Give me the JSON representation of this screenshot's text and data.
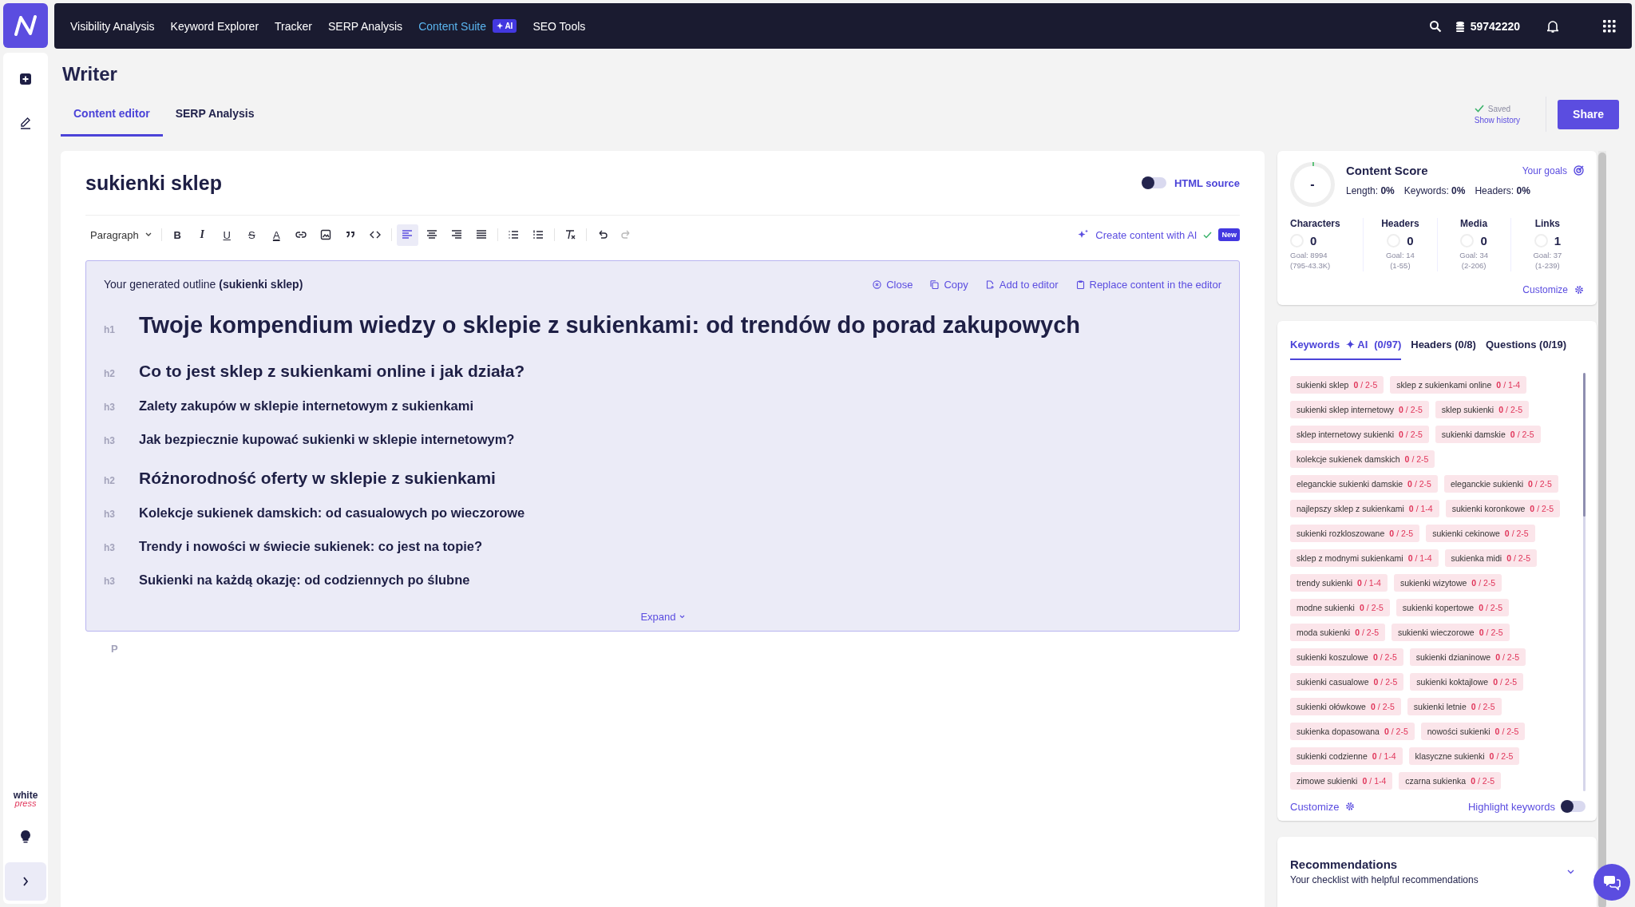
{
  "nav": {
    "items": [
      {
        "label": "Visibility Analysis",
        "selected": false
      },
      {
        "label": "Keyword Explorer",
        "selected": false
      },
      {
        "label": "Tracker",
        "selected": false
      },
      {
        "label": "SERP Analysis",
        "selected": false
      },
      {
        "label": "Content Suite",
        "selected": true,
        "badge": "✦ AI"
      },
      {
        "label": "SEO Tools",
        "selected": false
      }
    ],
    "credits": "59742220"
  },
  "page": {
    "title": "Writer",
    "tabs": [
      {
        "label": "Content editor",
        "selected": true
      },
      {
        "label": "SERP Analysis",
        "selected": false
      }
    ],
    "saved": "Saved",
    "history_link": "Show history",
    "share_button": "Share"
  },
  "editor": {
    "document_title": "sukienki sklep",
    "html_source": {
      "label": "HTML source",
      "on": false
    },
    "toolbar": [
      {
        "kind": "select",
        "label": "Paragraph"
      },
      {
        "kind": "bold",
        "label": "B",
        "selected": false
      },
      {
        "kind": "italic",
        "label": "I",
        "selected": false
      },
      {
        "kind": "underline",
        "label": "U",
        "selected": false
      },
      {
        "kind": "strike",
        "label": "S",
        "selected": false
      },
      {
        "kind": "color",
        "label": "A",
        "selected": false
      },
      {
        "kind": "link",
        "selected": false
      },
      {
        "kind": "image",
        "selected": false
      },
      {
        "kind": "quote",
        "selected": false
      },
      {
        "kind": "code",
        "selected": false
      },
      {
        "kind": "align-left",
        "selected": true
      },
      {
        "kind": "align-center",
        "selected": false
      },
      {
        "kind": "align-right",
        "selected": false
      },
      {
        "kind": "justify",
        "selected": false
      },
      {
        "kind": "bullets",
        "selected": false
      },
      {
        "kind": "numbers",
        "selected": false
      },
      {
        "kind": "clear",
        "selected": false
      },
      {
        "kind": "undo",
        "selected": false
      },
      {
        "kind": "redo",
        "selected": false,
        "disabled": true
      }
    ],
    "ai_button": "Create content with AI",
    "ai_badge": "New",
    "outline": {
      "title": "Your generated outline **(sukienki sklep)**",
      "actions": [
        {
          "kind": "close",
          "label": "Close"
        },
        {
          "kind": "copy",
          "label": "Copy"
        },
        {
          "kind": "add",
          "label": "Add to editor"
        },
        {
          "kind": "replace",
          "label": "Replace content in the editor"
        }
      ],
      "headings": [
        {
          "kind": "h1",
          "tag": "h1",
          "text": "Twoje kompendium wiedzy o sklepie z sukienkami: od trendów do porad zakupowych"
        },
        {
          "kind": "h2",
          "tag": "h2",
          "text": "Co to jest sklep z sukienkami online i jak działa?"
        },
        {
          "kind": "h3",
          "tag": "h3",
          "text": "Zalety zakupów w sklepie internetowym z sukienkami"
        },
        {
          "kind": "h3",
          "tag": "h3",
          "text": "Jak bezpiecznie kupować sukienki w sklepie internetowym?"
        },
        {
          "kind": "h2",
          "tag": "h2",
          "text": "Różnorodność oferty w sklepie z sukienkami"
        },
        {
          "kind": "h3",
          "tag": "h3",
          "text": "Kolekcje sukienek damskich: od casualowych po wieczorowe"
        },
        {
          "kind": "h3",
          "tag": "h3",
          "text": "Trendy i nowości w świecie sukienek: co jest na topie?"
        },
        {
          "kind": "h3",
          "tag": "h3",
          "text": "Sukienki na każdą okazję: od codziennych po ślubne"
        }
      ],
      "expand": "Expand"
    },
    "paragraph_tag": "P"
  },
  "score": {
    "title": "Content Score",
    "value": "-",
    "goals_link": "Your goals",
    "metrics": [
      "Length: **0%**",
      "Keywords: **0%**",
      "Headers: **0%**"
    ],
    "stats": [
      {
        "label": "Characters",
        "value": "0",
        "goal": "Goal: 8994",
        "range": "(795-43.3K)"
      },
      {
        "label": "Headers",
        "value": "0",
        "goal": "Goal: 14",
        "range": "(1-55)"
      },
      {
        "label": "Media",
        "value": "0",
        "goal": "Goal: 34",
        "range": "(2-206)"
      },
      {
        "label": "Links",
        "value": "1",
        "goal": "Goal: 37",
        "range": "(1-239)"
      }
    ],
    "customize": "Customize"
  },
  "keywords_panel": {
    "tabs": [
      {
        "label": "Keywords",
        "ai": "✦ AI",
        "count": "(0/97)",
        "selected": true
      },
      {
        "label": "Headers (0/8)",
        "selected": false
      },
      {
        "label": "Questions (0/19)",
        "selected": false
      }
    ],
    "keywords": [
      {
        "text": "sukienki sklep",
        "count": "0",
        "range": "/ 2-5"
      },
      {
        "text": "sklep z sukienkami online",
        "count": "0",
        "range": "/ 1-4"
      },
      {
        "text": "sukienki sklep internetowy",
        "count": "0",
        "range": "/ 2-5"
      },
      {
        "text": "sklep sukienki",
        "count": "0",
        "range": "/ 2-5"
      },
      {
        "text": "sklep internetowy sukienki",
        "count": "0",
        "range": "/ 2-5"
      },
      {
        "text": "sukienki damskie",
        "count": "0",
        "range": "/ 2-5"
      },
      {
        "text": "kolekcje sukienek damskich",
        "count": "0",
        "range": "/ 2-5"
      },
      {
        "text": "eleganckie sukienki damskie",
        "count": "0",
        "range": "/ 2-5"
      },
      {
        "text": "eleganckie sukienki",
        "count": "0",
        "range": "/ 2-5"
      },
      {
        "text": "najlepszy sklep z sukienkami",
        "count": "0",
        "range": "/ 1-4"
      },
      {
        "text": "sukienki koronkowe",
        "count": "0",
        "range": "/ 2-5"
      },
      {
        "text": "sukienki rozkloszowane",
        "count": "0",
        "range": "/ 2-5"
      },
      {
        "text": "sukienki cekinowe",
        "count": "0",
        "range": "/ 2-5"
      },
      {
        "text": "sklep z modnymi sukienkami",
        "count": "0",
        "range": "/ 1-4"
      },
      {
        "text": "sukienka midi",
        "count": "0",
        "range": "/ 2-5"
      },
      {
        "text": "trendy sukienki",
        "count": "0",
        "range": "/ 1-4"
      },
      {
        "text": "sukienki wizytowe",
        "count": "0",
        "range": "/ 2-5"
      },
      {
        "text": "modne sukienki",
        "count": "0",
        "range": "/ 2-5"
      },
      {
        "text": "sukienki kopertowe",
        "count": "0",
        "range": "/ 2-5"
      },
      {
        "text": "moda sukienki",
        "count": "0",
        "range": "/ 2-5"
      },
      {
        "text": "sukienki wieczorowe",
        "count": "0",
        "range": "/ 2-5"
      },
      {
        "text": "sukienki koszulowe",
        "count": "0",
        "range": "/ 2-5"
      },
      {
        "text": "sukienki dzianinowe",
        "count": "0",
        "range": "/ 2-5"
      },
      {
        "text": "sukienki casualowe",
        "count": "0",
        "range": "/ 2-5"
      },
      {
        "text": "sukienki koktajlowe",
        "count": "0",
        "range": "/ 2-5"
      },
      {
        "text": "sukienki ołówkowe",
        "count": "0",
        "range": "/ 2-5"
      },
      {
        "text": "sukienki letnie",
        "count": "0",
        "range": "/ 2-5"
      },
      {
        "text": "sukienka dopasowana",
        "count": "0",
        "range": "/ 2-5"
      },
      {
        "text": "nowości sukienki",
        "count": "0",
        "range": "/ 2-5"
      },
      {
        "text": "sukienki codzienne",
        "count": "0",
        "range": "/ 1-4"
      },
      {
        "text": "klasyczne sukienki",
        "count": "0",
        "range": "/ 2-5"
      },
      {
        "text": "zimowe sukienki",
        "count": "0",
        "range": "/ 1-4"
      },
      {
        "text": "czarna sukienka",
        "count": "0",
        "range": "/ 2-5"
      }
    ],
    "customize": "Customize",
    "highlight": {
      "label": "Highlight keywords",
      "on": false
    }
  },
  "recommendations": {
    "title": "Recommendations",
    "subtitle": "Your checklist with helpful recommendations"
  },
  "brand": {
    "top": "white",
    "bottom": "press"
  }
}
